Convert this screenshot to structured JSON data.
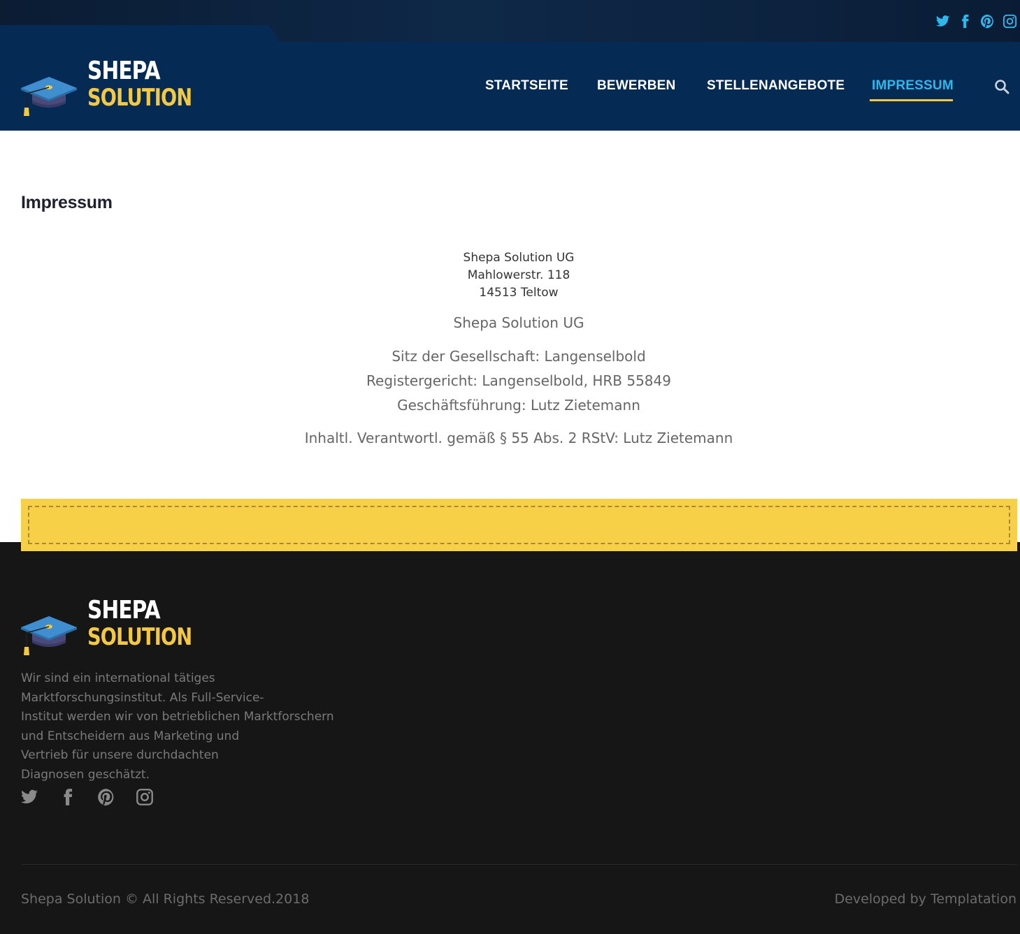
{
  "brand": {
    "line1": "SHEPA",
    "line2": "SOLUTION",
    "colors": {
      "primary": "#052b55",
      "accent": "#f5c842",
      "link": "#2fb7ec",
      "footer_bg": "#161616"
    }
  },
  "top_social": [
    "twitter-icon",
    "facebook-icon",
    "pinterest-icon",
    "instagram-icon"
  ],
  "nav": {
    "items": [
      {
        "label": "STARTSEITE",
        "active": false
      },
      {
        "label": "BEWERBEN",
        "active": false
      },
      {
        "label": "STELLENANGEBOTE",
        "active": false
      },
      {
        "label": "IMPRESSUM",
        "active": true
      }
    ],
    "search_icon": "search-icon"
  },
  "main": {
    "title": "Impressum",
    "address": [
      "Shepa Solution UG",
      "Mahlowerstr. 118",
      "14513 Teltow"
    ],
    "company_name": "Shepa Solution UG",
    "registry": [
      "Sitz der Gesellschaft: Langenselbold",
      "Registergericht: Langenselbold, HRB 55849",
      "Geschäftsführung: Lutz Zietemann"
    ],
    "responsible": "Inhaltl. Verantwortl. gemäß § 55 Abs. 2 RStV: Lutz Zietemann"
  },
  "footer": {
    "about_lines": [
      "Wir sind ein international tätiges",
      "Marktforschungsinstitut. Als Full-Service-",
      "Institut werden wir von betrieblichen Marktforschern",
      "und Entscheidern aus Marketing und",
      "Vertrieb für unsere durchdachten",
      "Diagnosen geschätzt."
    ],
    "social": [
      "twitter-icon",
      "facebook-icon",
      "pinterest-icon",
      "instagram-icon"
    ],
    "copyright": "Shepa Solution © All Rights Reserved.2018",
    "developed_by": "Developed by Templatation"
  }
}
